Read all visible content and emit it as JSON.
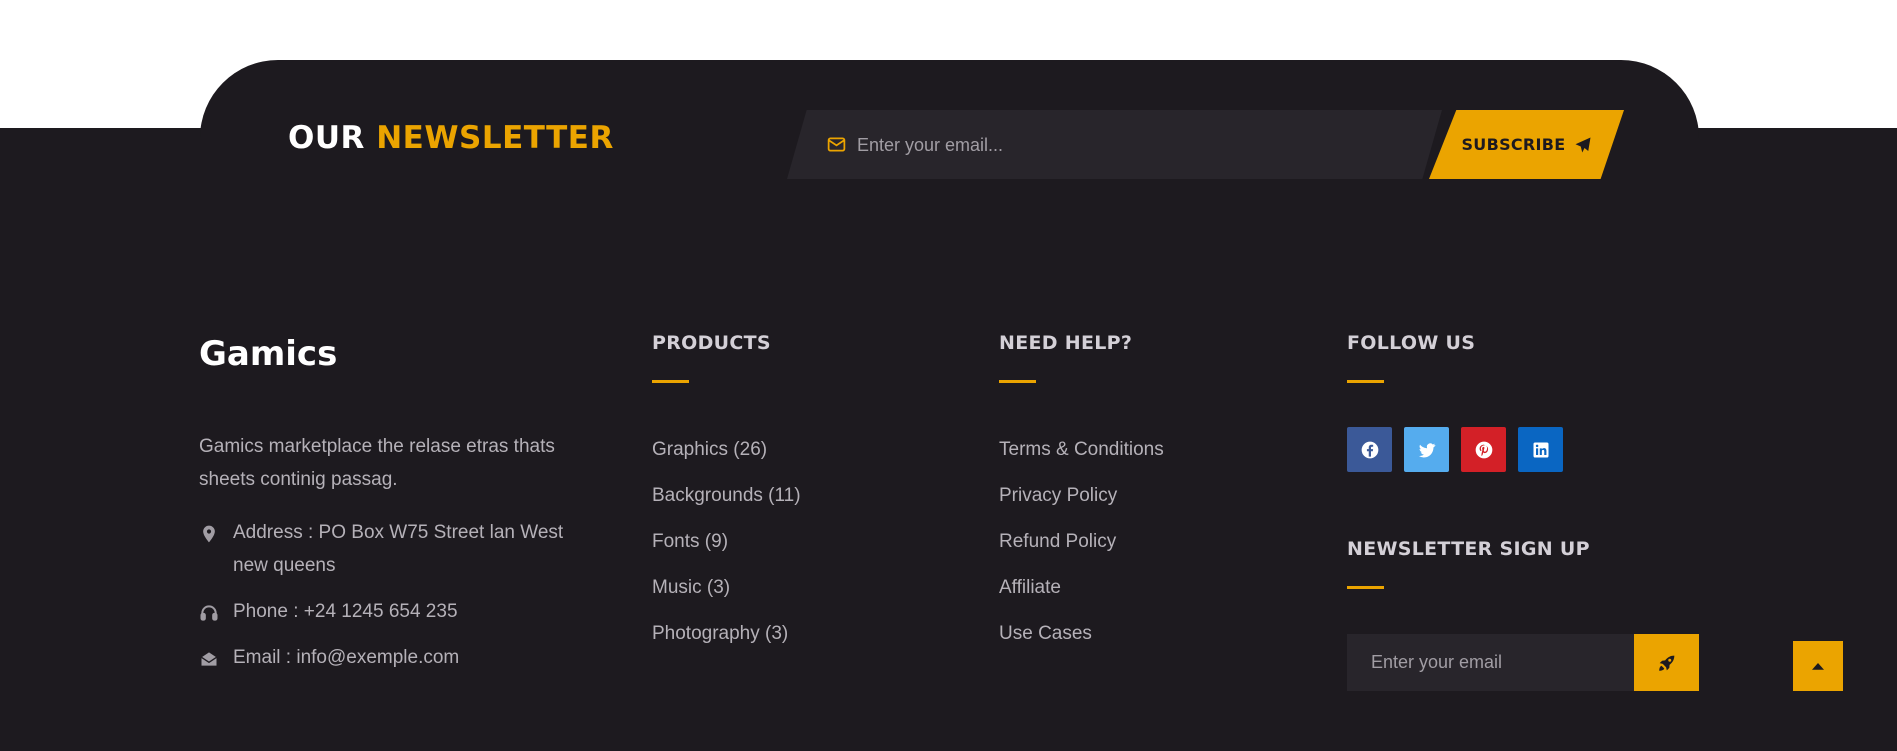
{
  "newsletter": {
    "title_prefix": "OUR",
    "title_accent": "NEWSLETTER",
    "email_placeholder": "Enter your email...",
    "subscribe_label": "SUBSCRIBE"
  },
  "about": {
    "brand": "Gamics",
    "description": "Gamics marketplace the relase etras thats sheets continig passag.",
    "address": "Address : PO Box W75 Street lan West new queens",
    "phone": "Phone : +24 1245 654 235",
    "email": "Email : info@exemple.com"
  },
  "products": {
    "heading": "PRODUCTS",
    "items": [
      "Graphics (26)",
      "Backgrounds (11)",
      "Fonts (9)",
      "Music (3)",
      "Photography (3)"
    ]
  },
  "help": {
    "heading": "NEED HELP?",
    "items": [
      "Terms & Conditions",
      "Privacy Policy",
      "Refund Policy",
      "Affiliate",
      "Use Cases"
    ]
  },
  "follow": {
    "heading": "FOLLOW US",
    "icons": [
      "facebook-icon",
      "twitter-icon",
      "pinterest-icon",
      "linkedin-icon"
    ],
    "colors": {
      "facebook": "#3b5998",
      "twitter": "#55acee",
      "pinterest": "#d32027",
      "linkedin": "#0a66c2"
    }
  },
  "signup": {
    "heading": "NEWSLETTER SIGN UP",
    "email_placeholder": "Enter your email"
  },
  "colors": {
    "accent": "#eba400",
    "background": "#1d1a1f",
    "input_bg": "#28252b"
  }
}
